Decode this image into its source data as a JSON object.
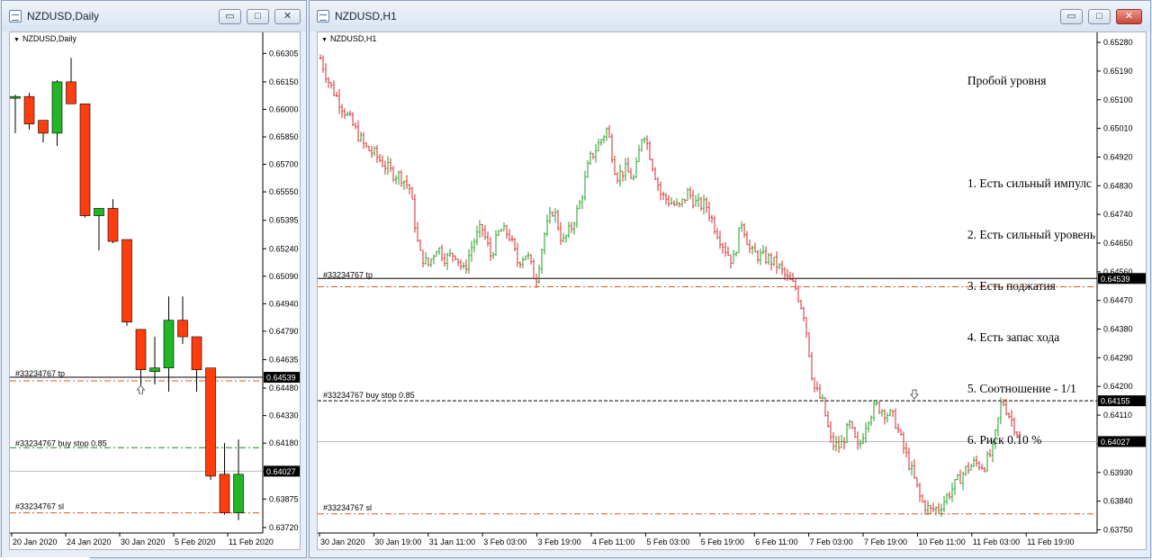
{
  "windows": {
    "daily": {
      "title": "NZDUSD,Daily",
      "symbol": "NZDUSD,Daily",
      "price_ticks": [
        "0.66305",
        "0.66150",
        "0.66000",
        "0.65850",
        "0.65700",
        "0.65550",
        "0.65395",
        "0.65240",
        "0.65090",
        "0.64940",
        "0.64790",
        "0.64635",
        "0.64480",
        "0.64330",
        "0.64180",
        "0.64025",
        "0.63875",
        "0.63720"
      ],
      "time_ticks": [
        "20 Jan 2020",
        "24 Jan 2020",
        "30 Jan 2020",
        "5 Feb 2020",
        "11 Feb 2020"
      ],
      "orders": {
        "tp": "#33234767 tp",
        "buy_stop": "#33234767 buy stop 0.85",
        "sl": "#33234767 sl"
      },
      "tags": {
        "tp": "0.64539",
        "current": "0.64027"
      }
    },
    "h1": {
      "title": "NZDUSD,H1",
      "symbol": "NZDUSD,H1",
      "price_ticks": [
        "0.65280",
        "0.65190",
        "0.65100",
        "0.65010",
        "0.64920",
        "0.64830",
        "0.64740",
        "0.64650",
        "0.64560",
        "0.64470",
        "0.64380",
        "0.64290",
        "0.64200",
        "0.64110",
        "0.64020",
        "0.63930",
        "0.63840",
        "0.63750"
      ],
      "time_ticks": [
        "30 Jan 2020",
        "30 Jan 19:00",
        "31 Jan 11:00",
        "3 Feb 03:00",
        "3 Feb 19:00",
        "4 Feb 11:00",
        "5 Feb 03:00",
        "5 Feb 19:00",
        "6 Feb 11:00",
        "7 Feb 03:00",
        "7 Feb 19:00",
        "10 Feb 11:00",
        "11 Feb 03:00",
        "11 Feb 19:00"
      ],
      "orders": {
        "tp": "#33234767 tp",
        "buy_stop": "#33234767 buy stop 0.85",
        "sl": "#33234767 sl"
      },
      "tags": {
        "tp": "0.64539",
        "buy_stop": "0.64155",
        "current": "0.64027"
      },
      "note": {
        "title": "Пробой уровня",
        "items": [
          "1. Есть сильный импулс",
          "2. Есть сильный уровень",
          "3. Есть поджатия",
          "4. Есть запас хода",
          "5. Соотношение - 1/1",
          "6. Риск 0.10 %"
        ]
      }
    }
  },
  "controls": {
    "minimize": "▭",
    "restore": "□",
    "close": "✕"
  },
  "colors": {
    "bull": "#21b626",
    "bear": "#ff3d0e",
    "tp_line": "#000000",
    "order_line": "#e2561a",
    "stop_line": "#1b8a1b",
    "current_line": "#bdbdbd",
    "h1_bull": "#1f9c1f",
    "h1_bear": "#d42a2a"
  },
  "chart_data": [
    {
      "type": "candlestick",
      "title": "NZDUSD,Daily",
      "ylim": [
        0.6369,
        0.6639
      ],
      "candles": [
        {
          "o": 0.6607,
          "h": 0.6608,
          "l": 0.6587,
          "c": 0.6607
        },
        {
          "o": 0.6607,
          "h": 0.6609,
          "l": 0.6589,
          "c": 0.6592
        },
        {
          "o": 0.6594,
          "h": 0.6594,
          "l": 0.6582,
          "c": 0.6587
        },
        {
          "o": 0.6587,
          "h": 0.6616,
          "l": 0.658,
          "c": 0.6615
        },
        {
          "o": 0.6615,
          "h": 0.6628,
          "l": 0.6604,
          "c": 0.6603
        },
        {
          "o": 0.6603,
          "h": 0.6603,
          "l": 0.6541,
          "c": 0.6542
        },
        {
          "o": 0.6542,
          "h": 0.6546,
          "l": 0.6523,
          "c": 0.6546
        },
        {
          "o": 0.6546,
          "h": 0.6551,
          "l": 0.6527,
          "c": 0.6528
        },
        {
          "o": 0.6529,
          "h": 0.6529,
          "l": 0.6482,
          "c": 0.6484
        },
        {
          "o": 0.648,
          "h": 0.648,
          "l": 0.6447,
          "c": 0.6458
        },
        {
          "o": 0.6457,
          "h": 0.6476,
          "l": 0.645,
          "c": 0.6459
        },
        {
          "o": 0.6459,
          "h": 0.6498,
          "l": 0.6446,
          "c": 0.6485
        },
        {
          "o": 0.6485,
          "h": 0.6498,
          "l": 0.6472,
          "c": 0.6476
        },
        {
          "o": 0.6476,
          "h": 0.6476,
          "l": 0.6446,
          "c": 0.6458
        },
        {
          "o": 0.6459,
          "h": 0.6459,
          "l": 0.6398,
          "c": 0.64
        },
        {
          "o": 0.6401,
          "h": 0.6418,
          "l": 0.6379,
          "c": 0.638
        },
        {
          "o": 0.638,
          "h": 0.642,
          "l": 0.6376,
          "c": 0.6401
        }
      ],
      "levels": {
        "tp": 0.64539,
        "buy_stop": 0.64155,
        "current": 0.64027,
        "sl": 0.638
      }
    },
    {
      "type": "candlestick",
      "title": "NZDUSD,H1",
      "ylim": [
        0.6374,
        0.653
      ],
      "waypoints": [
        0.6523,
        0.6515,
        0.651,
        0.6505,
        0.65,
        0.6495,
        0.6493,
        0.649,
        0.6487,
        0.6486,
        0.6482,
        0.6462,
        0.6458,
        0.6464,
        0.646,
        0.6462,
        0.6456,
        0.6465,
        0.647,
        0.6461,
        0.6469,
        0.6468,
        0.6459,
        0.6462,
        0.6453,
        0.6468,
        0.6476,
        0.6465,
        0.647,
        0.6478,
        0.6491,
        0.6496,
        0.6501,
        0.6486,
        0.6488,
        0.6485,
        0.6501,
        0.649,
        0.648,
        0.6478,
        0.6476,
        0.6481,
        0.6477,
        0.6477,
        0.647,
        0.6464,
        0.6459,
        0.6472,
        0.6462,
        0.6461,
        0.646,
        0.6458,
        0.6454,
        0.6451,
        0.6442,
        0.642,
        0.6415,
        0.6402,
        0.6401,
        0.6408,
        0.64,
        0.641,
        0.6414,
        0.6412,
        0.641,
        0.6401,
        0.6393,
        0.6384,
        0.6381,
        0.6382,
        0.6386,
        0.639,
        0.6394,
        0.6396,
        0.6395,
        0.64,
        0.6416,
        0.641,
        0.6404
      ],
      "levels": {
        "tp": 0.64539,
        "order_line": 0.64513,
        "buy_stop": 0.64155,
        "current": 0.64027,
        "sl": 0.638
      }
    }
  ]
}
